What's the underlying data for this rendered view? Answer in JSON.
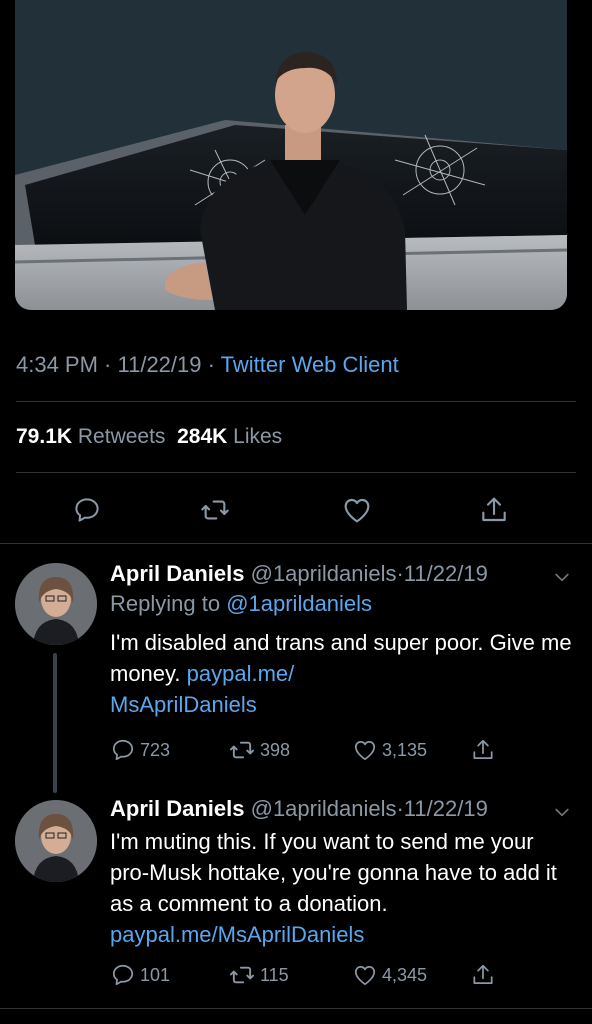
{
  "tweet": {
    "time": "4:34 PM",
    "sep1": " · ",
    "date": "11/22/19",
    "sep2": " · ",
    "client": "Twitter Web Client",
    "retweets_count": "79.1K",
    "retweets_label": "Retweets",
    "likes_count": "284K",
    "likes_label": "Likes"
  },
  "replies": [
    {
      "name": "April Daniels",
      "handle": "@1aprildaniels",
      "dot": "·",
      "date": "11/22/19",
      "replying_prefix": "Replying to ",
      "replying_to": "@1aprildaniels",
      "text": "I'm disabled and trans and super poor. Give me money. ",
      "link": "paypal.me/\nMsAprilDaniels",
      "reply_count": "723",
      "retweet_count": "398",
      "like_count": "3,135"
    },
    {
      "name": "April Daniels",
      "handle": "@1aprildaniels",
      "dot": "·",
      "date": "11/22/19",
      "text": "I'm muting this. If you want to send me your pro-Musk hottake, you're gonna have to add it as a comment to a donation. ",
      "link": "paypal.me/MsAprilDaniels",
      "reply_count": "101",
      "retweet_count": "115",
      "like_count": "4,345"
    }
  ],
  "colors": {
    "accent": "#5aa7ee",
    "muted": "#8b98a5",
    "divider": "#2f3336",
    "background": "#000000"
  },
  "icons": [
    "reply-icon",
    "retweet-icon",
    "like-icon",
    "share-icon",
    "chevron-down-icon"
  ]
}
